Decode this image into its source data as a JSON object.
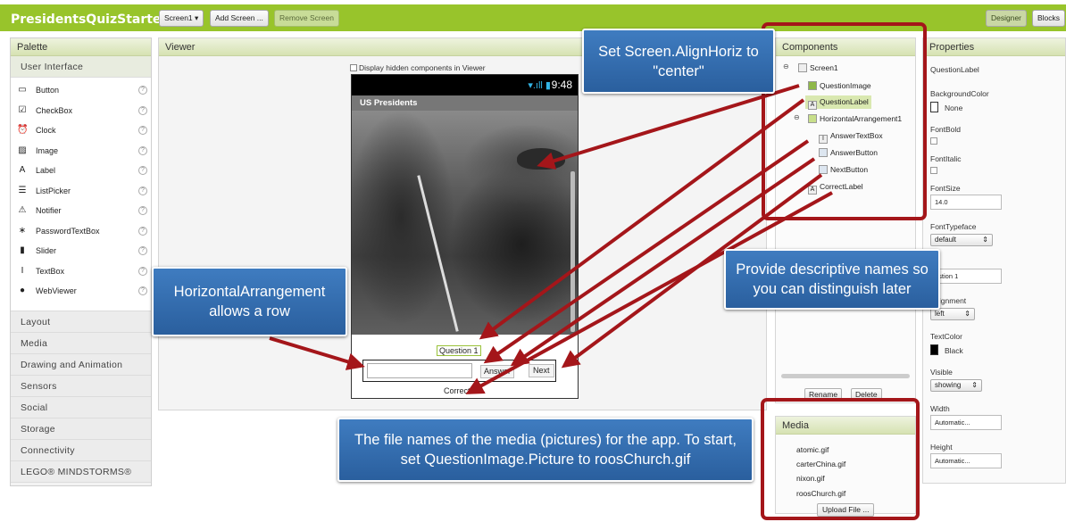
{
  "app": {
    "project_title": "PresidentsQuizStarter",
    "screen_select": "Screen1 ▾",
    "add_screen": "Add Screen ...",
    "remove_screen": "Remove Screen",
    "designer": "Designer",
    "blocks": "Blocks"
  },
  "palette": {
    "header": "Palette",
    "user_interface": "User Interface",
    "items": [
      {
        "label": "Button",
        "icon": "button-icon",
        "glyph": "▭"
      },
      {
        "label": "CheckBox",
        "icon": "checkbox-icon",
        "glyph": "☑"
      },
      {
        "label": "Clock",
        "icon": "clock-icon",
        "glyph": "⏰"
      },
      {
        "label": "Image",
        "icon": "image-icon",
        "glyph": "▨"
      },
      {
        "label": "Label",
        "icon": "label-icon",
        "glyph": "A"
      },
      {
        "label": "ListPicker",
        "icon": "listpicker-icon",
        "glyph": "☰"
      },
      {
        "label": "Notifier",
        "icon": "notifier-icon",
        "glyph": "⚠"
      },
      {
        "label": "PasswordTextBox",
        "icon": "password-icon",
        "glyph": "∗"
      },
      {
        "label": "Slider",
        "icon": "slider-icon",
        "glyph": "▮"
      },
      {
        "label": "TextBox",
        "icon": "textbox-icon",
        "glyph": "I"
      },
      {
        "label": "WebViewer",
        "icon": "globe-icon",
        "glyph": "●"
      }
    ],
    "help_glyph": "?",
    "categories": [
      "Layout",
      "Media",
      "Drawing and Animation",
      "Sensors",
      "Social",
      "Storage",
      "Connectivity",
      "LEGO® MINDSTORMS®"
    ]
  },
  "viewer": {
    "header": "Viewer",
    "hidden_components": "Display hidden components in Viewer",
    "status_icons": "▾.ıll ▮",
    "time": "9:48",
    "screen_title": "US Presidents",
    "question_label": "Question 1",
    "answer_button": "Answer",
    "next_button": "Next",
    "correct_label": "Correct!"
  },
  "components": {
    "header": "Components",
    "tree": [
      "Screen1",
      "QuestionImage",
      "QuestionLabel",
      "HorizontalArrangement1",
      "AnswerTextBox",
      "AnswerButton",
      "NextButton",
      "CorrectLabel"
    ],
    "rename": "Rename",
    "delete": "Delete"
  },
  "media": {
    "header": "Media",
    "files": [
      "atomic.gif",
      "carterChina.gif",
      "nixon.gif",
      "roosChurch.gif"
    ],
    "upload": "Upload File ..."
  },
  "properties": {
    "header": "Properties",
    "component": "QuestionLabel",
    "background_color_label": "BackgroundColor",
    "background_color_value": "None",
    "fontbold_label": "FontBold",
    "fontitalic_label": "FontItalic",
    "fontsize_label": "FontSize",
    "fontsize_value": "14.0",
    "fonttypeface_label": "FontTypeface",
    "fonttypeface_value": "default",
    "text_label": "t",
    "text_value": "estion 1",
    "textalignment_label": "tAlignment",
    "textalignment_value": "left",
    "textcolor_label": "TextColor",
    "textcolor_value": "Black",
    "visible_label": "Visible",
    "visible_value": "showing",
    "width_label": "Width",
    "width_value": "Automatic...",
    "height_label": "Height",
    "height_value": "Automatic..."
  },
  "callouts": {
    "align": "Set Screen.AlignHoriz to \"center\"",
    "harrange": "HorizontalArrangement allows a row",
    "names": "Provide descriptive names so you can distinguish later",
    "media": "The file names of the media (pictures) for the app. To start, set QuestionImage.Picture to roosChurch.gif"
  },
  "colors": {
    "topbar": "#98c42b",
    "callout": "#2f68ab",
    "annotation": "#a4161a"
  }
}
